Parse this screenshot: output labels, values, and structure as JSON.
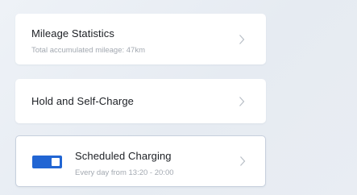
{
  "items": [
    {
      "title": "Mileage Statistics",
      "subtitle": "Total accumulated mileage: 47km",
      "chevron_icon": "chevron-right-icon"
    },
    {
      "title": "Hold and Self-Charge",
      "chevron_icon": "chevron-right-icon"
    },
    {
      "title": "Scheduled Charging",
      "subtitle": "Every day from 13:20 - 20:00",
      "toggle": {
        "on": true,
        "icon": "toggle-switch-icon"
      },
      "chevron_icon": "chevron-right-icon"
    }
  ],
  "colors": {
    "background": "#e9edf3",
    "card": "#ffffff",
    "title": "#1c1f24",
    "subtitle": "#a3a9b1",
    "accent": "#2165d3",
    "chevron": "#b8bec6",
    "selected_border": "#c7d0dd"
  }
}
